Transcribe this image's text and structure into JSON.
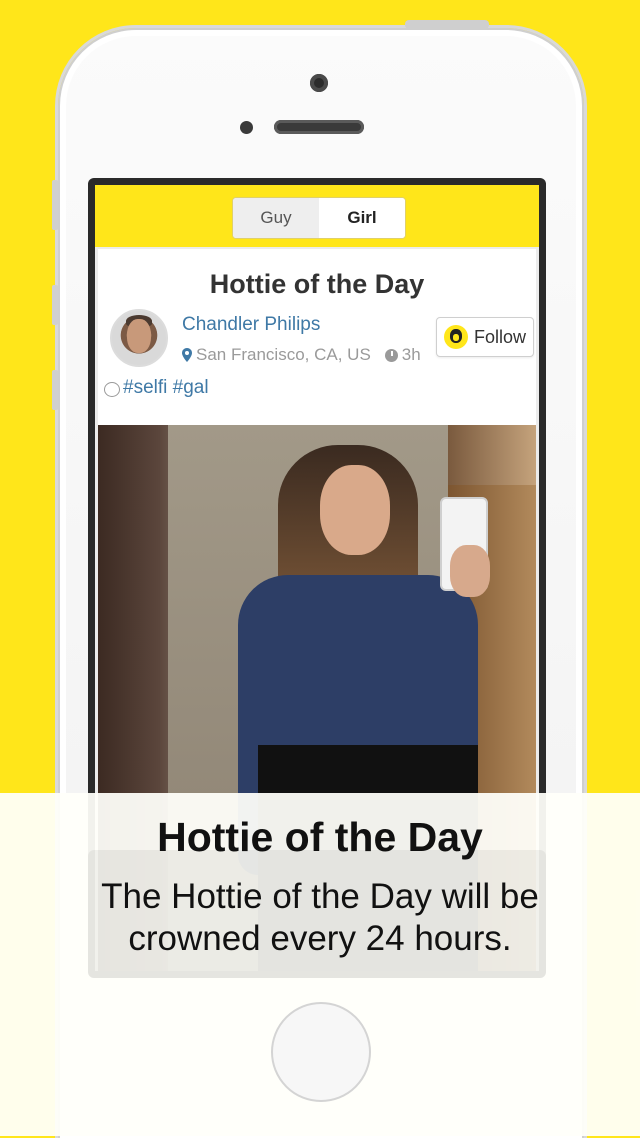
{
  "colors": {
    "brand_yellow": "#FFE61A",
    "link_blue": "#3F79A6",
    "meta_gray": "#9A9A9A"
  },
  "segment": {
    "guy_label": "Guy",
    "girl_label": "Girl",
    "selected": "Girl"
  },
  "card": {
    "title": "Hottie of the Day",
    "user_name": "Chandler Philips",
    "location": "San Francisco, CA, US",
    "time_ago": "3h",
    "follow_label": "Follow",
    "tags": "#selfi #gal"
  },
  "caption": {
    "title": "Hottie of the Day",
    "text": "The Hottie of the Day will be crowned every 24 hours."
  },
  "icons": [
    "pin-icon",
    "clock-icon",
    "chat-icon",
    "follow-avatar-icon"
  ]
}
